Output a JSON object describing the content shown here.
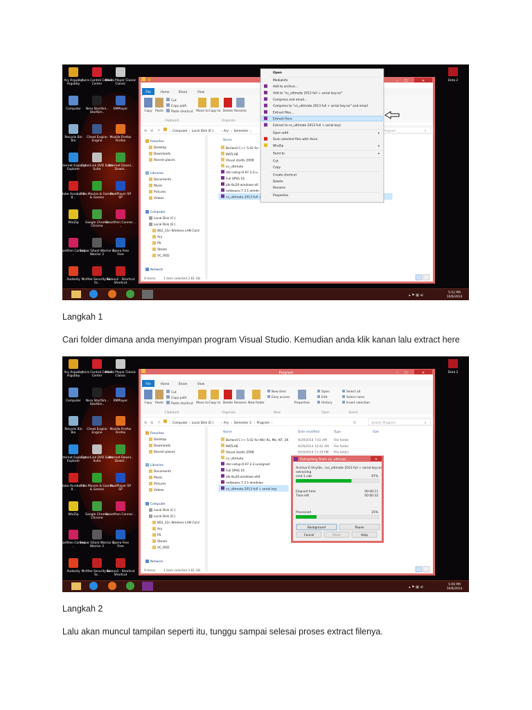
{
  "desktop": {
    "icons": [
      {
        "label": "Ary Argubby",
        "icon": "user-icon",
        "color": "#e0a020"
      },
      {
        "label": "Avira Control Center",
        "icon": "avira-icon",
        "color": "#d0202a"
      },
      {
        "label": "Media Player Classic",
        "icon": "film-icon",
        "color": "#c8c8c8"
      },
      {
        "label": "Computer",
        "icon": "computer-icon",
        "color": "#5a8ad0"
      },
      {
        "label": "Nero StartSm..",
        "icon": "nero-icon",
        "color": "#222222"
      },
      {
        "label": "KMPlayer",
        "icon": "kmplayer-icon",
        "color": "#3a6ac0"
      },
      {
        "label": "Recycle Bin",
        "icon": "recycle-bin-icon",
        "color": "#8ab0d0"
      },
      {
        "label": "Cheat Engine",
        "icon": "cheat-engine-icon",
        "color": "#3a5a90"
      },
      {
        "label": "Mozilla Firefox",
        "icon": "firefox-icon",
        "color": "#e07020"
      },
      {
        "label": "Internet Explorer",
        "icon": "ie-icon",
        "color": "#2a8ae0"
      },
      {
        "label": "CyberLink DVD Suite",
        "icon": "dvd-icon",
        "color": "#c0c0c0"
      },
      {
        "label": "Internet Downl..",
        "icon": "idm-icon",
        "color": "#3a9a3a"
      },
      {
        "label": "Adobe Acrobat 8 ..",
        "icon": "acrobat-icon",
        "color": "#d02020"
      },
      {
        "label": "Free Movies & Games",
        "icon": "games-icon",
        "color": "#30a030"
      },
      {
        "label": "RealPlayer SP",
        "icon": "realplayer-icon",
        "color": "#2050c0"
      },
      {
        "label": "WinZip",
        "icon": "winzip-icon",
        "color": "#e0c020"
      },
      {
        "label": "Google Chrome",
        "icon": "chrome-icon",
        "color": "#40a040"
      },
      {
        "label": "Smartfren Connec ..",
        "icon": "smartfren-icon",
        "color": "#d02060"
      },
      {
        "label": "Smartfren Connec ..",
        "icon": "smartfren-icon",
        "color": "#d02060"
      },
      {
        "label": "Sniper Ghost Warrior 2",
        "icon": "sniper-icon",
        "color": "#5a5a5a"
      },
      {
        "label": "Opera Free",
        "icon": "opera-icon",
        "color": "#2060c0"
      },
      {
        "label": "Audacity",
        "icon": "audacity-icon",
        "color": "#e04020"
      },
      {
        "label": "McAfee Security Sc..",
        "icon": "mcafee-icon",
        "color": "#c02020"
      },
      {
        "label": "Kamus2 - Shortcut",
        "icon": "kamus-icon",
        "color": "#c02020"
      }
    ],
    "right_icon_label": "Dota 2"
  },
  "shot1": {
    "tabs": [
      "File",
      "Home",
      "Share",
      "View"
    ],
    "ribbon_small": [
      "Cut",
      "Copy path",
      "Paste shortcut"
    ],
    "ribbon_big": [
      "Copy",
      "Paste",
      "Move to",
      "Copy to",
      "Delete",
      "Rename"
    ],
    "ribbon_groups": [
      "Clipboard",
      "Organize"
    ],
    "breadcrumb": [
      "Computer",
      "Local Disk (E:)",
      "Ary",
      "Semester"
    ],
    "search_placeholder": "Program",
    "column_name": "Name",
    "nav_items": [
      "Favorites",
      "Desktop",
      "Downloads",
      "Recent places",
      "Libraries",
      "Documents",
      "Music",
      "Pictures",
      "Videos",
      "Computer",
      "Local Disk (C:)",
      "Local Disk (E:)",
      "802_11n Wireless LAN Card",
      "Ary",
      "PS",
      "Steam",
      "VC_RED",
      "Network"
    ],
    "files": [
      "Borland C++ 5.02 for",
      "MATLAB",
      "Visual studio 2008",
      "vs_ultimate",
      "dlsr-setup-9.97.2-2-u",
      "Full SPSS 16",
      "jdk-8u20-windows-x6",
      "netbeans-7.3.1-windo",
      "vs_ultimate 2013 full + serial key"
    ],
    "status": [
      "9 items",
      "1 item selected 2.81 GB"
    ],
    "context_menu": [
      "Open",
      "MediaInfo",
      "Add to archive...",
      "Add to \"vs_ultimate 2013 full + serial key.rar\"",
      "Compress and email...",
      "Compress to \"vs_ultimate 2013 full + serial key.rar\" and email",
      "Extract files...",
      "Extract Here",
      "Extract to vs_ultimate 2013 full + serial key\\",
      "Open with",
      "Scan selected files with Avira",
      "WinZip",
      "Send to",
      "Cut",
      "Copy",
      "Create shortcut",
      "Delete",
      "Rename",
      "Properties"
    ],
    "highlighted_item": "Extract Here",
    "tray_time": "5:52 PM",
    "tray_date": "10/6/2014"
  },
  "caption1_title": "Langkah 1",
  "caption1_text": "Cari folder dimana anda menyimpan program Visual Studio. Kemudian anda klik kanan lalu extract here",
  "shot2": {
    "window_title": "Program",
    "tabs": [
      "File",
      "Home",
      "Share",
      "View"
    ],
    "ribbon_small": [
      "Cut",
      "Copy path",
      "Paste shortcut"
    ],
    "ribbon_big": [
      "Copy",
      "Paste",
      "Move to",
      "Copy to",
      "Delete",
      "Rename",
      "New folder",
      "Properties"
    ],
    "ribbon_right": [
      "New item",
      "Easy access",
      "Open",
      "Edit",
      "History",
      "Select all",
      "Select none",
      "Invert selection"
    ],
    "ribbon_groups": [
      "Clipboard",
      "Organize",
      "New",
      "Open",
      "Select"
    ],
    "breadcrumb": [
      "Computer",
      "Local Disk (E:)",
      "Ary",
      "Semester 3",
      "Program"
    ],
    "search_placeholder": "Search Program",
    "columns": [
      "Name",
      "Date modified",
      "Type",
      "Size"
    ],
    "files": [
      {
        "name": "Borland C++ 5.02 for Win 9x, Me, NT, 2K",
        "date": "9/29/2014 7:02 AM",
        "type": "File folder"
      },
      {
        "name": "MATLAB",
        "date": "9/29/2014 10:42 AM",
        "type": "File folder"
      },
      {
        "name": "Visual studio 2008",
        "date": "9/29/2014 11:19 PM",
        "type": "File folder"
      },
      {
        "name": "vs_ultimate",
        "date": "",
        "type": ""
      },
      {
        "name": "dlsr-setup-9.97.2-2-unsigned",
        "date": "",
        "type": ""
      },
      {
        "name": "Full SPSS 16",
        "date": "",
        "type": ""
      },
      {
        "name": "jdk-8u20-windows-x64",
        "date": "",
        "type": ""
      },
      {
        "name": "netbeans-7.3.1-windows",
        "date": "",
        "type": ""
      },
      {
        "name": "vs_ultimate 2013 full + serial key",
        "date": "",
        "type": ""
      }
    ],
    "nav_items": [
      "Favorites",
      "Desktop",
      "Downloads",
      "Recent places",
      "Libraries",
      "Documents",
      "Music",
      "Pictures",
      "Videos",
      "Computer",
      "Local Disk (C:)",
      "Local Disk (E:)",
      "802_11n Wireless LAN Card",
      "Ary",
      "PS",
      "Steam",
      "VC_RED",
      "Network"
    ],
    "status": [
      "9 items",
      "1 item selected 2.81 GB"
    ],
    "dialog": {
      "title": "Extracting from vs_ultimat...",
      "archive_line": "Archive E:\\Ary\\Se...\\vs_ultimate 2013 full + serial key.rar",
      "extracting": "extracting",
      "file": "cmd 1.cab",
      "file_percent": "67%",
      "file_progress": 0.67,
      "elapsed_label": "Elapsed time",
      "elapsed": "00:00:11",
      "timeleft_label": "Time left",
      "timeleft": "00:00:32",
      "processed_label": "Processed",
      "processed_percent": "25%",
      "processed_progress": 0.25,
      "buttons": [
        "Background",
        "Pause",
        "Cancel",
        "Mode",
        "Help"
      ]
    },
    "tray_time": "5:00 PM",
    "tray_date": "10/6/2014"
  },
  "caption2_title": "Langkah 2",
  "caption2_text": "Lalu akan muncul tampilan seperti itu, tunggu sampai selesai proses extract filenya."
}
